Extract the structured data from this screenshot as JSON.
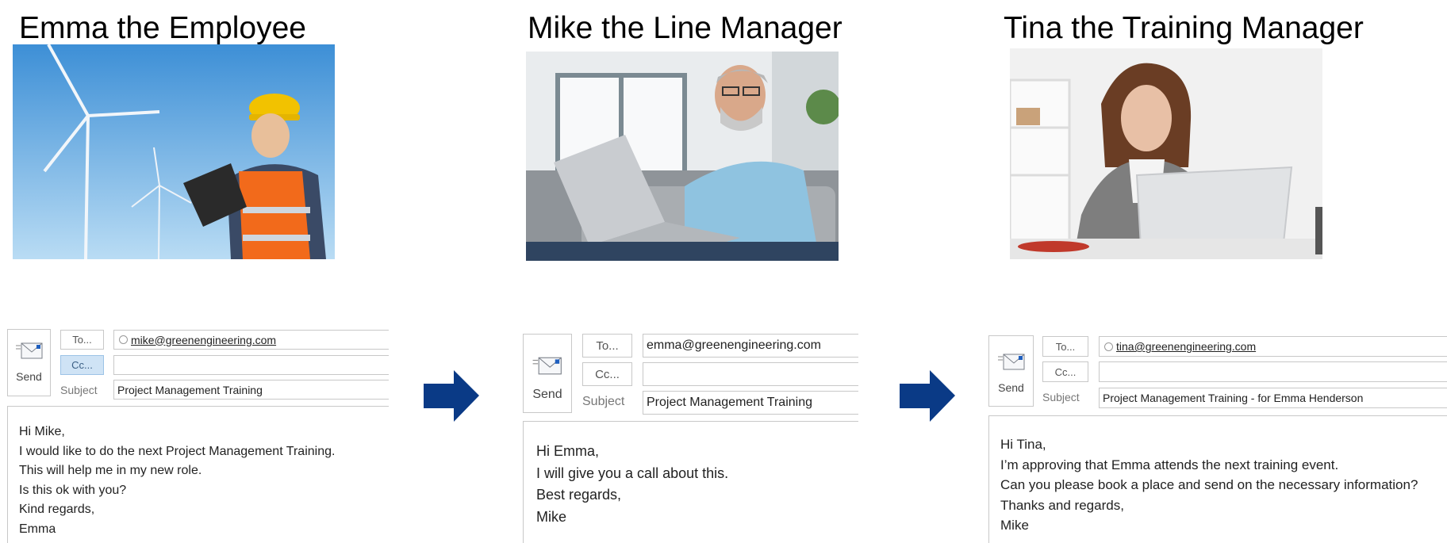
{
  "personas": [
    {
      "title": "Emma the Employee",
      "photo": "employee-photo"
    },
    {
      "title": "Mike the Line Manager",
      "photo": "line-manager-photo"
    },
    {
      "title": "Tina the Training Manager",
      "photo": "training-manager-photo"
    }
  ],
  "emails": [
    {
      "send_label": "Send",
      "to_label": "To...",
      "cc_label": "Cc...",
      "subject_label": "Subject",
      "to_value": "mike@greenengineering.com",
      "cc_value": "",
      "subject_value": "Project Management Training",
      "body": [
        "Hi Mike,",
        "I would like to do the next Project Management Training.",
        "This will help me in my new role.",
        "Is this ok with you?",
        "Kind regards,",
        "Emma"
      ]
    },
    {
      "send_label": "Send",
      "to_label": "To...",
      "cc_label": "Cc...",
      "subject_label": "Subject",
      "to_value": "emma@greenengineering.com",
      "cc_value": "",
      "subject_value": "Project Management Training",
      "body": [
        "Hi Emma,",
        "I will give you a call about this.",
        "Best regards,",
        "Mike"
      ]
    },
    {
      "send_label": "Send",
      "to_label": "To...",
      "cc_label": "Cc...",
      "subject_label": "Subject",
      "to_value": "tina@greenengineering.com",
      "cc_value": "",
      "subject_value": "Project Management Training - for Emma Henderson",
      "body": [
        "Hi Tina,",
        "I’m approving that Emma attends the next training event.",
        "Can you please book a place and send on the necessary information?",
        "Thanks and regards,",
        "Mike"
      ]
    }
  ],
  "colors": {
    "arrow": "#0a3a86",
    "cc_active": "#cfe3f5"
  }
}
